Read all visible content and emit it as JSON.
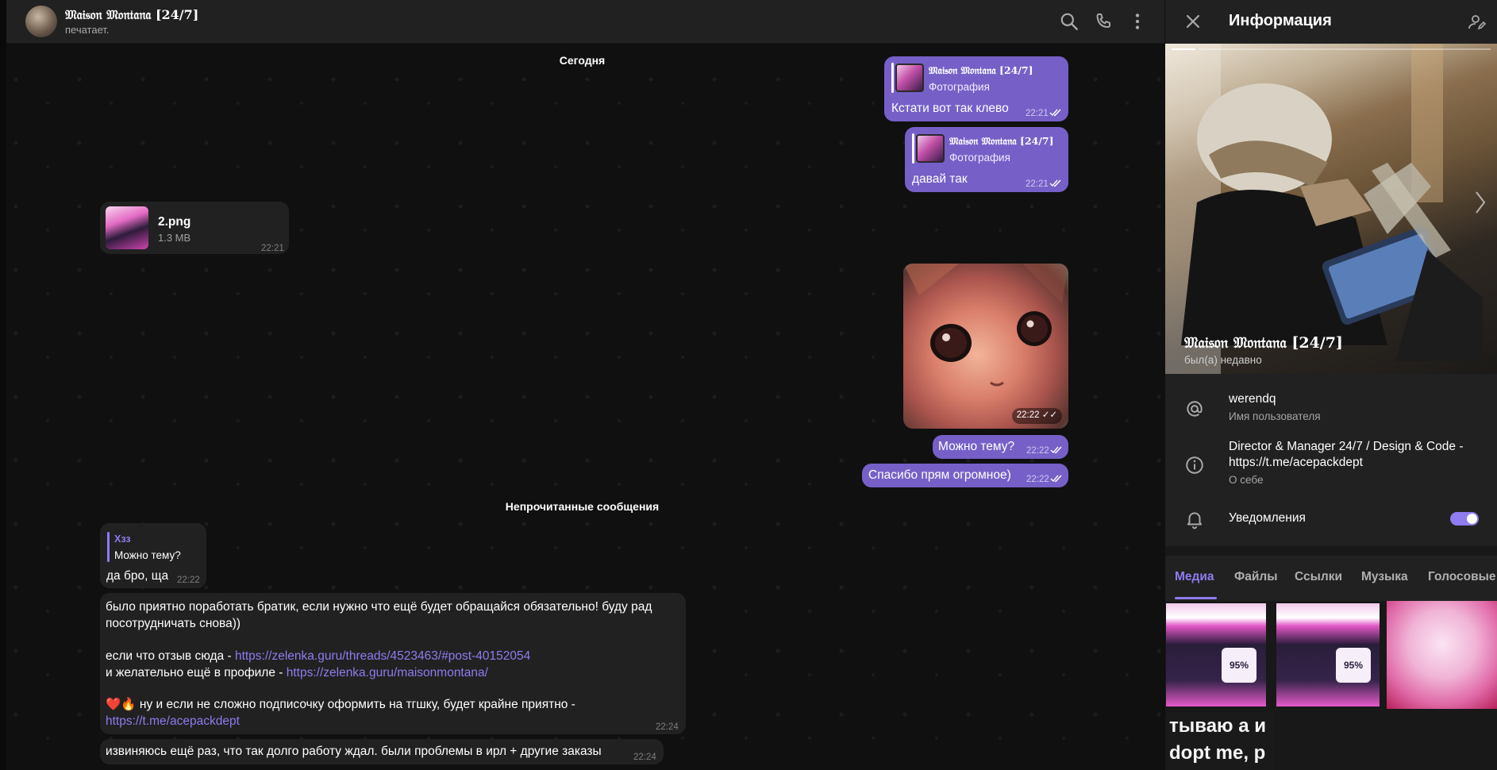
{
  "header": {
    "chat_name": "𝔐𝔞𝔦𝔰𝔬𝔫 𝔐𝔬𝔫𝔱𝔞𝔫𝔞 [24/7]",
    "status": "печатает."
  },
  "date_separator": "Сегодня",
  "unread_separator": "Непрочитанные сообщения",
  "messages": {
    "m1": {
      "reply_name": "𝔐𝔞𝔦𝔰𝔬𝔫 𝔐𝔬𝔫𝔱𝔞𝔫𝔞 [24/7]",
      "reply_text": "Фотография",
      "text": "Кстати вот так клево",
      "time": "22:21"
    },
    "m2": {
      "reply_name": "𝔐𝔞𝔦𝔰𝔬𝔫 𝔐𝔬𝔫𝔱𝔞𝔫𝔞 [24/7]",
      "reply_text": "Фотография",
      "text": "давай так",
      "time": "22:21"
    },
    "file": {
      "name": "2.png",
      "size": "1.3 MB",
      "time": "22:21"
    },
    "photo": {
      "time": "22:22"
    },
    "m3": {
      "text": "Можно тему?",
      "time": "22:22"
    },
    "m4": {
      "text": "Спасибо прям огромное)",
      "time": "22:22"
    },
    "m5": {
      "reply_name": "Хзз",
      "reply_text": "Можно тему?",
      "text": "да бро, ща",
      "time": "22:22"
    },
    "m6": {
      "line1": "было приятно поработать братик, если нужно что ещё будет обращайся обязательно! буду рад",
      "line2": "посотрудничать снова))",
      "line3_prefix": "если что отзыв сюда - ",
      "line3_link": "https://zelenka.guru/threads/4523463/#post-40152054",
      "line4_prefix": "и желательно ещё в профиле - ",
      "line4_link": "https://zelenka.guru/maisonmontana/",
      "line5": "❤️🔥 ну и если не сложно подписочку оформить на тгшку, будет крайне приятно -",
      "line6_link": "https://t.me/acepackdept",
      "time": "22:24"
    },
    "m7": {
      "text": "извиняюсь ещё раз, что так долго работу ждал. были проблемы в ирл + другие заказы",
      "time": "22:24"
    }
  },
  "panel": {
    "title": "Информация",
    "profile_name": "𝔐𝔞𝔦𝔰𝔬𝔫 𝔐𝔬𝔫𝔱𝔞𝔫𝔞 [24/7]",
    "last_seen": "был(а) недавно",
    "username": "werendq",
    "username_label": "Имя пользователя",
    "bio": "Director & Manager 24/7 / Design & Code -",
    "bio_link": "https://t.me/acepackdept",
    "bio_label": "О себе",
    "notifications_label": "Уведомления",
    "notifications_on": true,
    "tabs": [
      "Медиа",
      "Файлы",
      "Ссылки",
      "Музыка",
      "Голосовые"
    ],
    "media_text_1": "тываю а и",
    "media_text_2": "dopt me, p"
  },
  "colors": {
    "accent": "#8e7cf0",
    "outgoing_bubble": "#7660c8",
    "incoming_bubble": "#212121",
    "panel_bg": "#212121"
  }
}
